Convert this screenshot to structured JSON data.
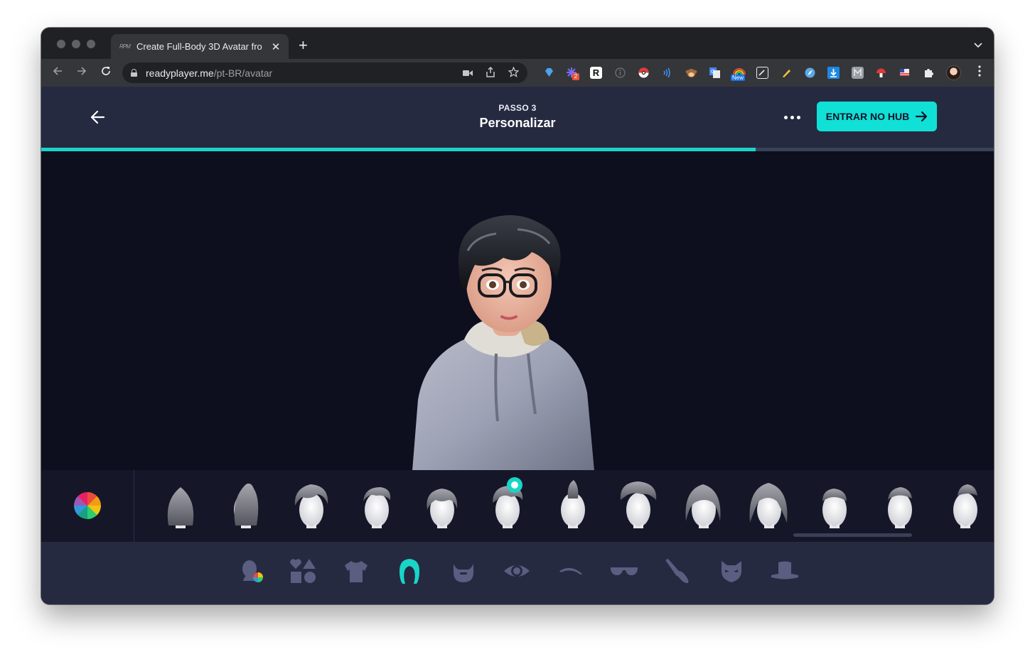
{
  "browser": {
    "tab_title": "Create Full-Body 3D Avatar fro",
    "tab_favicon": "RPM",
    "new_tab_label": "+",
    "tab_close_label": "✕",
    "url_host": "readyplayer.me",
    "url_path": "/pt-BR/avatar",
    "extension_badge_count": "2",
    "extension_new_badge": "New",
    "extension_r_label": "R"
  },
  "header": {
    "step_label": "PASSO 3",
    "step_title": "Personalizar",
    "hub_button_label": "ENTRAR NO HUB",
    "progress_fraction": 0.75
  },
  "hair_bar": {
    "selected_index": 5,
    "items": [
      {
        "name": "hair-style-long-bob"
      },
      {
        "name": "hair-style-ponytail"
      },
      {
        "name": "hair-style-wavy-short"
      },
      {
        "name": "hair-style-side-swept"
      },
      {
        "name": "hair-style-curly-bob"
      },
      {
        "name": "hair-style-messy-fringe"
      },
      {
        "name": "hair-style-mohawk"
      },
      {
        "name": "hair-style-voluminous"
      },
      {
        "name": "hair-style-long-wavy"
      },
      {
        "name": "hair-style-long-curly"
      },
      {
        "name": "hair-style-crew-cut"
      },
      {
        "name": "hair-style-short-side-part"
      },
      {
        "name": "hair-style-undercut"
      }
    ]
  },
  "categories": [
    {
      "name": "skin-color-icon",
      "active": false
    },
    {
      "name": "face-shape-icon",
      "active": false
    },
    {
      "name": "outfit-icon",
      "active": false
    },
    {
      "name": "hair-icon",
      "active": true
    },
    {
      "name": "beard-icon",
      "active": false
    },
    {
      "name": "eye-icon",
      "active": false
    },
    {
      "name": "eyebrow-icon",
      "active": false
    },
    {
      "name": "glasses-icon",
      "active": false
    },
    {
      "name": "makeup-brush-icon",
      "active": false
    },
    {
      "name": "mask-icon",
      "active": false
    },
    {
      "name": "hat-icon",
      "active": false
    }
  ],
  "colors": {
    "accent": "#11e0d6",
    "app_background": "#0d0f1e",
    "header_background": "#262a41",
    "icon_inactive": "#5a5e80"
  }
}
